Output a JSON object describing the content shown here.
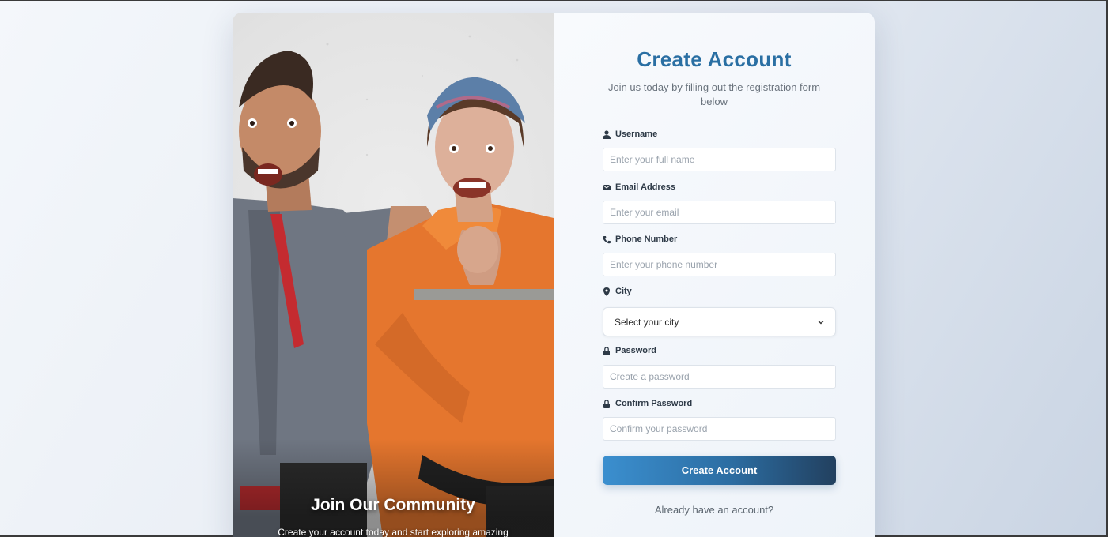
{
  "hero": {
    "title": "Join Our Community",
    "subtitle": "Create your account today and start exploring amazing"
  },
  "form": {
    "title": "Create Account",
    "subtitle": "Join us today by filling out the registration form below",
    "fields": {
      "username": {
        "label": "Username",
        "placeholder": "Enter your full name",
        "icon": "user-icon"
      },
      "email": {
        "label": "Email Address",
        "placeholder": "Enter your email",
        "icon": "envelope-icon"
      },
      "phone": {
        "label": "Phone Number",
        "placeholder": "Enter your phone number",
        "icon": "phone-icon"
      },
      "city": {
        "label": "City",
        "selected": "Select your city",
        "icon": "map-pin-icon"
      },
      "password": {
        "label": "Password",
        "placeholder": "Create a password",
        "icon": "lock-icon"
      },
      "confirm_password": {
        "label": "Confirm Password",
        "placeholder": "Confirm your password",
        "icon": "lock-icon"
      }
    },
    "submit_label": "Create Account",
    "signin_prompt": "Already have an account?"
  },
  "colors": {
    "title": "#2a6fa3",
    "button_start": "#3b8fcf",
    "button_end": "#22405f"
  }
}
